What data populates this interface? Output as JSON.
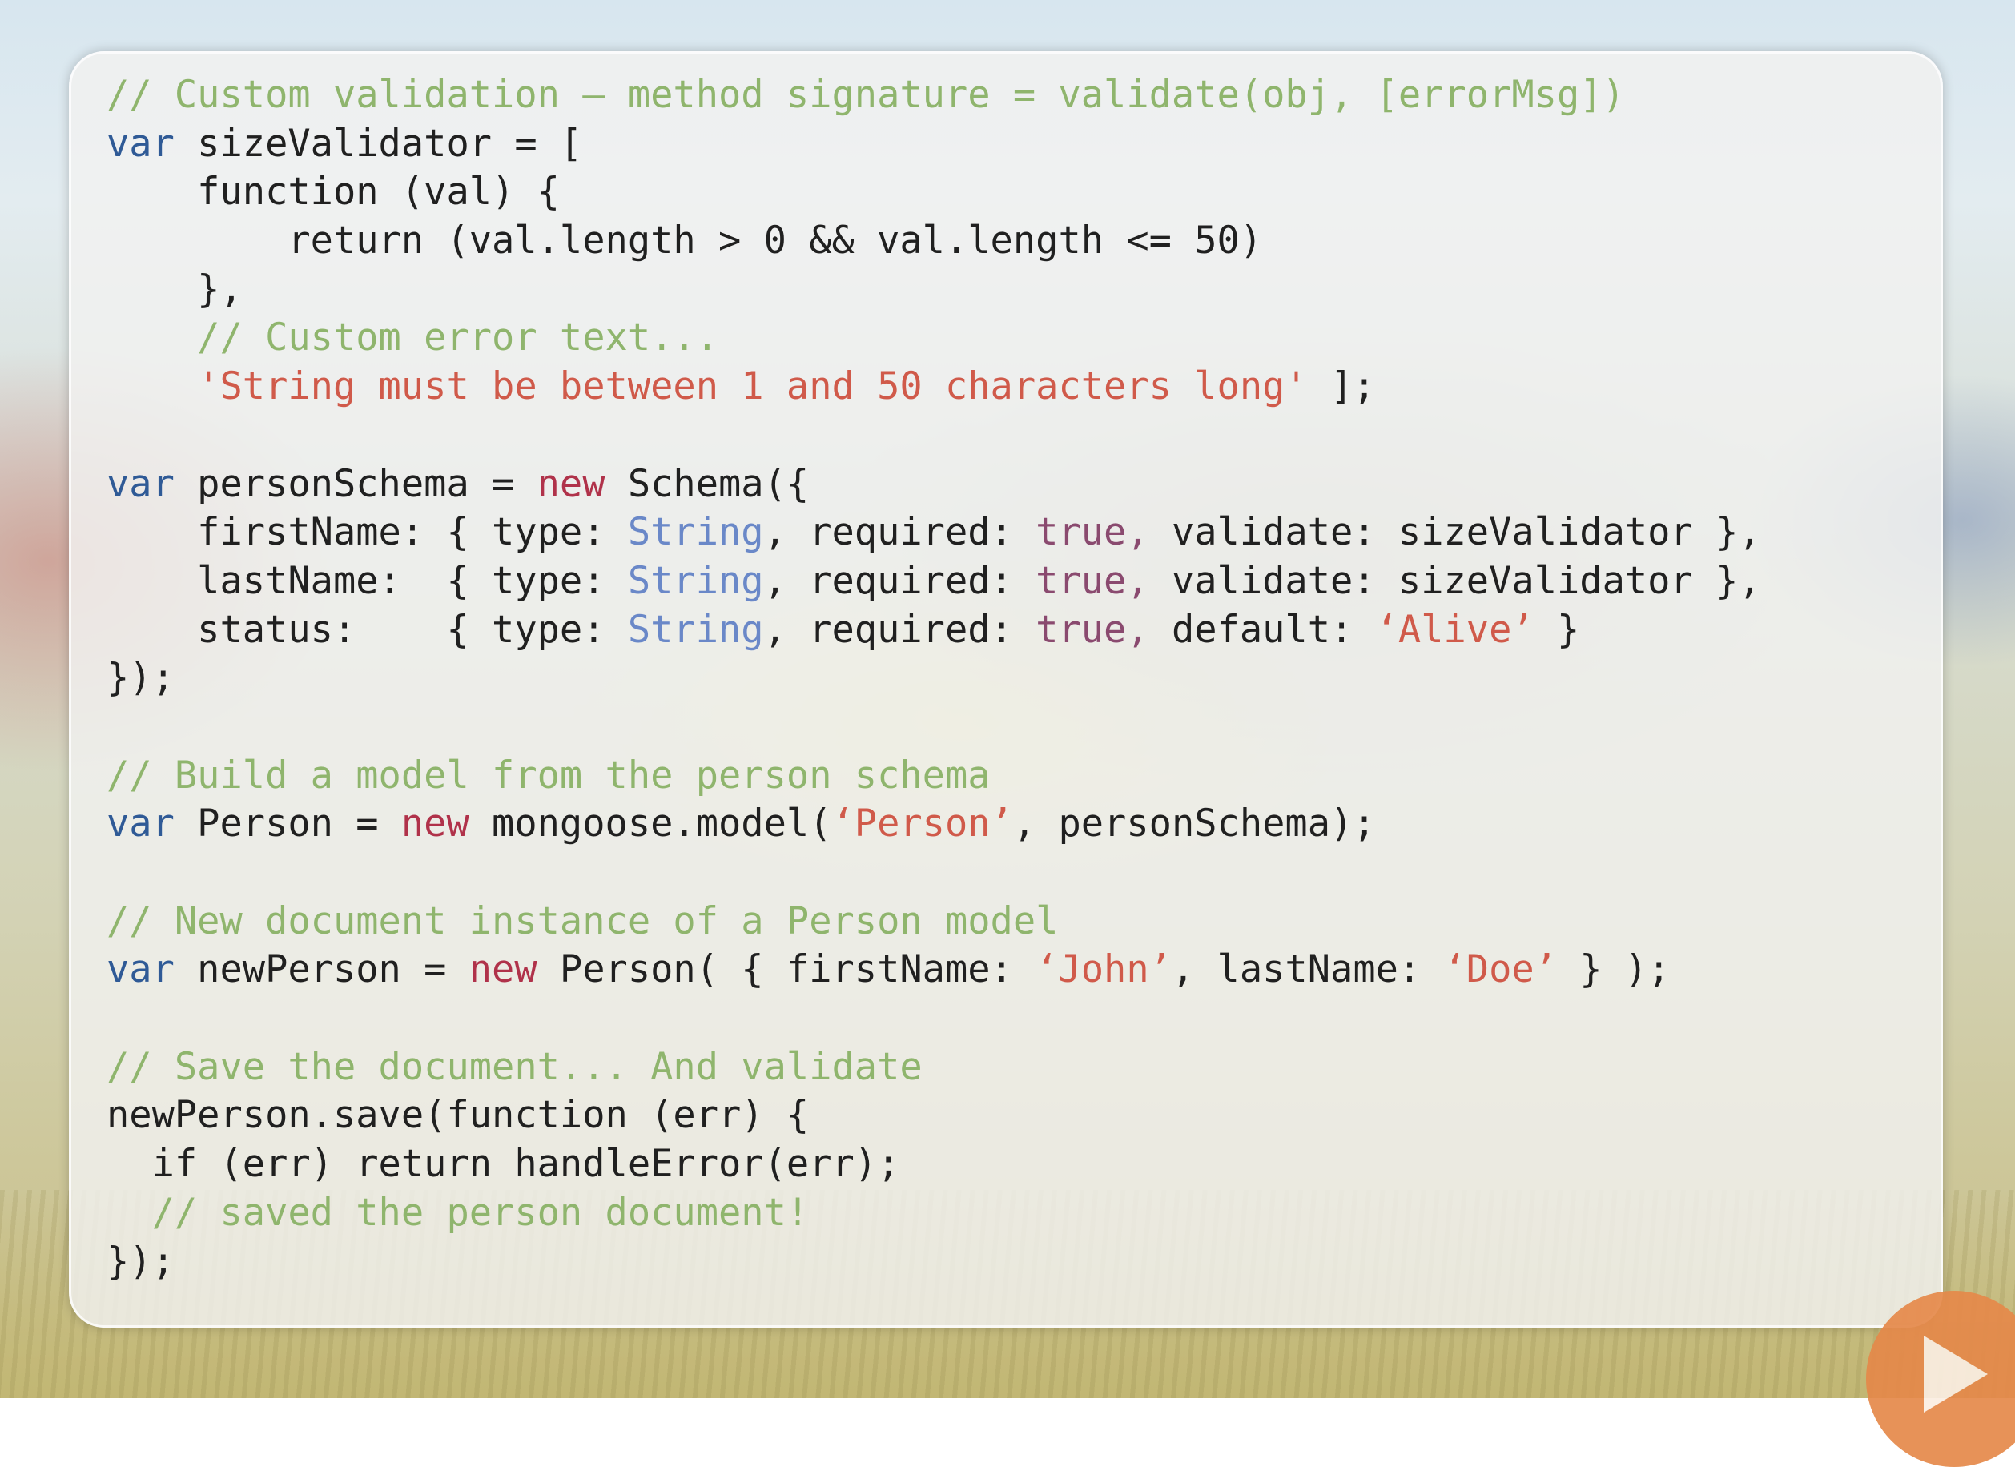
{
  "code": {
    "lines": [
      [
        {
          "t": "// Custom validation – method signature = validate(obj, [errorMsg])",
          "c": "cm"
        }
      ],
      [
        {
          "t": "var",
          "c": "kw"
        },
        {
          "t": " sizeValidator = [",
          "c": ""
        }
      ],
      [
        {
          "t": "    function (val) {",
          "c": ""
        }
      ],
      [
        {
          "t": "        return (val.length > 0 && val.length <= 50)",
          "c": ""
        }
      ],
      [
        {
          "t": "    },",
          "c": ""
        }
      ],
      [
        {
          "t": "    // Custom error text...",
          "c": "cm"
        }
      ],
      [
        {
          "t": "    'String must be between 1 and 50 characters long'",
          "c": "st"
        },
        {
          "t": " ];",
          "c": ""
        }
      ],
      [],
      [
        {
          "t": "var",
          "c": "kw"
        },
        {
          "t": " personSchema = ",
          "c": ""
        },
        {
          "t": "new",
          "c": "nw"
        },
        {
          "t": " Schema({",
          "c": ""
        }
      ],
      [
        {
          "t": "    firstName: { type: ",
          "c": ""
        },
        {
          "t": "String",
          "c": "ty"
        },
        {
          "t": ", required: ",
          "c": ""
        },
        {
          "t": "true,",
          "c": "bo"
        },
        {
          "t": " validate: sizeValidator },",
          "c": ""
        }
      ],
      [
        {
          "t": "    lastName:  { type: ",
          "c": ""
        },
        {
          "t": "String",
          "c": "ty"
        },
        {
          "t": ", required: ",
          "c": ""
        },
        {
          "t": "true,",
          "c": "bo"
        },
        {
          "t": " validate: sizeValidator },",
          "c": ""
        }
      ],
      [
        {
          "t": "    status:    { type: ",
          "c": ""
        },
        {
          "t": "String",
          "c": "ty"
        },
        {
          "t": ", required: ",
          "c": ""
        },
        {
          "t": "true,",
          "c": "bo"
        },
        {
          "t": " default: ",
          "c": ""
        },
        {
          "t": "‘Alive’",
          "c": "st"
        },
        {
          "t": " }",
          "c": ""
        }
      ],
      [
        {
          "t": "});",
          "c": ""
        }
      ],
      [],
      [
        {
          "t": "// Build a model from the person schema",
          "c": "cm"
        }
      ],
      [
        {
          "t": "var",
          "c": "kw"
        },
        {
          "t": " Person = ",
          "c": ""
        },
        {
          "t": "new",
          "c": "nw"
        },
        {
          "t": " mongoose.model(",
          "c": ""
        },
        {
          "t": "‘Person’",
          "c": "st"
        },
        {
          "t": ", personSchema);",
          "c": ""
        }
      ],
      [],
      [
        {
          "t": "// New document instance of a Person model",
          "c": "cm"
        }
      ],
      [
        {
          "t": "var",
          "c": "kw"
        },
        {
          "t": " newPerson = ",
          "c": ""
        },
        {
          "t": "new",
          "c": "nw"
        },
        {
          "t": " Person( { firstName: ",
          "c": ""
        },
        {
          "t": "‘John’",
          "c": "st"
        },
        {
          "t": ", lastName: ",
          "c": ""
        },
        {
          "t": "‘Doe’",
          "c": "st"
        },
        {
          "t": " } );",
          "c": ""
        }
      ],
      [],
      [
        {
          "t": "// Save the document... And validate",
          "c": "cm"
        }
      ],
      [
        {
          "t": "newPerson.save(function (err) {",
          "c": ""
        }
      ],
      [
        {
          "t": "  if (err) return handleError(err);",
          "c": ""
        }
      ],
      [
        {
          "t": "  // saved the person document!",
          "c": "cm"
        }
      ],
      [
        {
          "t": "});",
          "c": ""
        }
      ]
    ]
  },
  "colors": {
    "comment": "#8fb56d",
    "keyword_var": "#2f5a96",
    "keyword_new": "#b0324a",
    "string": "#d05a4a",
    "type": "#6a88c8",
    "boolean": "#8a4a6f",
    "text": "#202020",
    "play_button": "#e5894a"
  },
  "icons": {
    "play": "play-icon"
  }
}
